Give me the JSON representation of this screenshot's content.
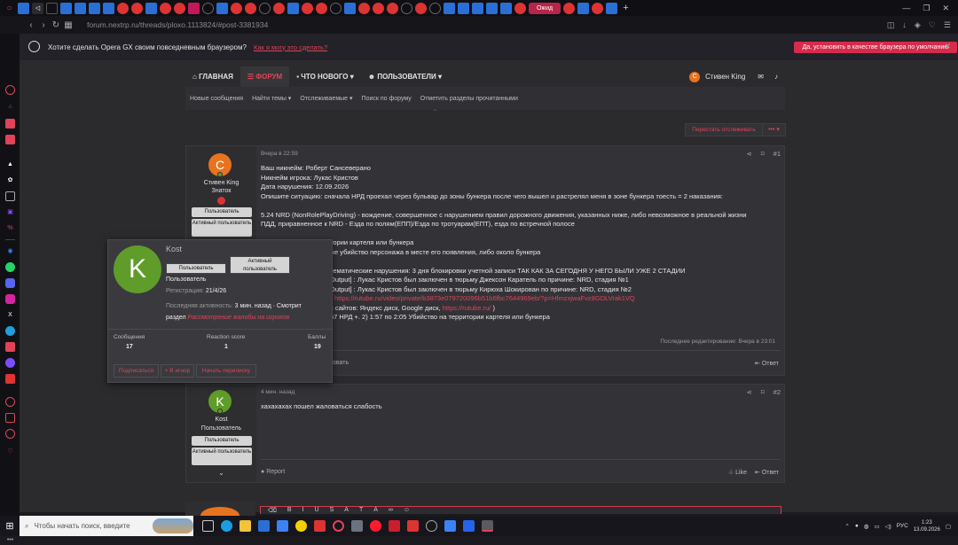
{
  "browser": {
    "tab_active_label": "Ожид",
    "url": "forum.nextrp.ru/threads/ploxo.1113824/#post-3381934"
  },
  "banner": {
    "text": "Хотите сделать Opera GX своим повседневным браузером?",
    "link": "Как я могу это сделать?",
    "button": "Да, установить в качестве браузера по умолчанию"
  },
  "forum_nav": {
    "items": [
      "ГЛАВНАЯ",
      "ФОРУМ",
      "ЧТО НОВОГО",
      "ПОЛЬЗОВАТЕЛИ"
    ],
    "user": "Стивен King",
    "user_initial": "С"
  },
  "subnav": [
    "Новые сообщения",
    "Найти темы",
    "Отслеживаемые",
    "Поиск по форуму",
    "Отметить разделы прочитанными"
  ],
  "thread_actions": {
    "unwatch": "Перестать отслеживать",
    "more": "•••"
  },
  "post1": {
    "author": "Стивен King",
    "initial": "C",
    "title": "Знаток",
    "roles": [
      "Пользователь",
      "Активный пользователь"
    ],
    "time": "Вчера в 22:59",
    "num": "#1",
    "lines": [
      "Ваш никнейм: Роберт Сансеверано",
      "Никнейм игрока: Лукас Кристов",
      "Дата нарушения: 12.09.2026",
      "Опишите ситуацию: сначала НРД проехал через бульвар до зоны бункера после чего вышел и растрелял меня в зоне бункера тоесть = 2 наказания:",
      "",
      "5.24 NRD (NonRolePlayDriving) - вождение, совершенное с нарушением правил дорожного движения, указанных ниже, либо невозможное в реальной жизни",
      "ПДД, приравненное к NRD - Езда по полям(ЕПП)/Езда по тротуарам(ЕПТ), езда по встречной полосе"
    ],
    "hidden_lines": [
      "тории картеля или бункера",
      "же убийство персонажа в месте его появления, либо около бункера",
      "",
      "тематические нарушения: 3 дня блокировки учетной записи ТАК КАК ЗА СЕГОДНЯ У НЕГО БЫЛИ УЖЕ 2 СТАДИИ",
      "Output] : Лукас Кристов был заключен в тюрьму Джексон Каратель по причине: NRD, стадия №1",
      "Output] : Лукас Кристов был заключен в тюрьму Кирюха Шокирован по причине: NRD, стадия №2"
    ],
    "video_link": "https://rutube.ru/video/private/b3873e079720096b51b6fbc7644969eb/?p=HfmzxjwaFvz8GDLVrak1VQ",
    "sites_prefix": "с сайтов: Яндекс диск, Google диск,",
    "sites_link": "https://rutube.ru/",
    "sites_suffix": ")",
    "timecodes": "57 НРД +. 2) 1:57 по 2:05 Убийство на территории картеля или бункера",
    "edited": "Последнее редактирование: Вчера в 23:01",
    "report_partial": "овать",
    "reply": "Ответ"
  },
  "popup": {
    "name": "Kost",
    "initial": "K",
    "roles": [
      "Пользователь",
      "Активный пользователь"
    ],
    "title": "Пользователь",
    "reg_label": "Регистрация:",
    "reg_value": "21/4/26",
    "activity_label": "Последняя активность:",
    "activity_value": "3 мин. назад",
    "activity_sep": "· Смотрит",
    "activity_where": "раздел",
    "activity_link": "Рассмотрение жалобы на игроков",
    "stats": [
      {
        "label": "Сообщения",
        "value": "17"
      },
      {
        "label": "Reaction score",
        "value": "1"
      },
      {
        "label": "Баллы",
        "value": "19"
      }
    ],
    "actions": [
      "Подписаться",
      "+ В игнор",
      "Начать переписку"
    ]
  },
  "post2": {
    "author": "Kost",
    "initial": "K",
    "title": "Пользователь",
    "roles": [
      "Пользователь",
      "Активный пользователь"
    ],
    "time": "4 мин. назад",
    "num": "#2",
    "text": "хахахахах пошел жаловаться слабость",
    "report": "Report",
    "like": "Like",
    "reply": "Ответ"
  },
  "taskbar": {
    "search_placeholder": "Чтобы начать поиск, введите",
    "lang": "РУС",
    "time": "1:23",
    "date": "13.09.2026"
  },
  "colors": {
    "accent": "#e04358",
    "orange": "#e8731f",
    "green": "#5f9c2a"
  }
}
